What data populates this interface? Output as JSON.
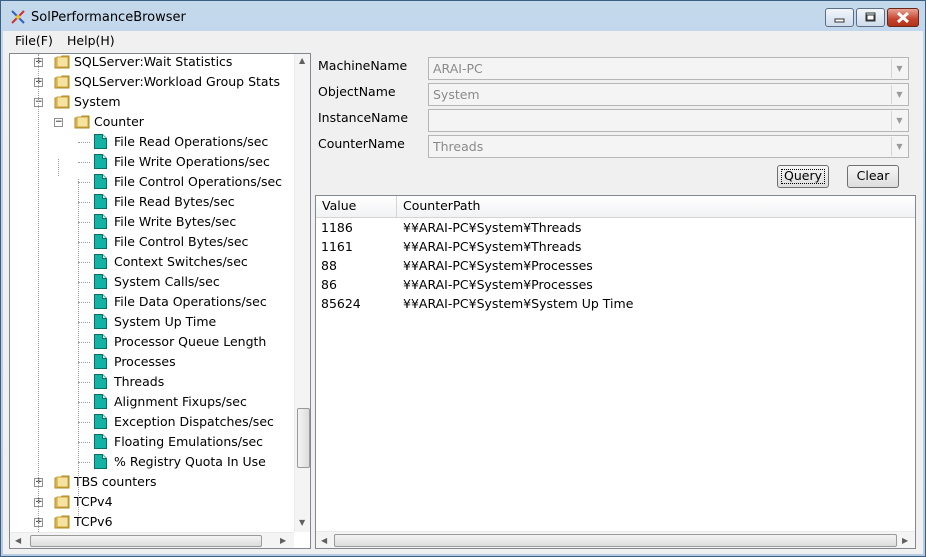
{
  "window": {
    "title": "SolPerformanceBrowser"
  },
  "menu": [
    {
      "label": "File(F)"
    },
    {
      "label": "Help(H)"
    }
  ],
  "tree": {
    "rows": [
      {
        "label": "SQLServer:Wait Statistics",
        "level": 1,
        "kind": "folder",
        "expander": "+"
      },
      {
        "label": "SQLServer:Workload Group Stats",
        "level": 1,
        "kind": "folder",
        "expander": "+"
      },
      {
        "label": "System",
        "level": 1,
        "kind": "folder",
        "expander": "-"
      },
      {
        "label": "Counter",
        "level": 2,
        "kind": "folder",
        "expander": "-"
      },
      {
        "label": "File Read Operations/sec",
        "level": 3,
        "kind": "item"
      },
      {
        "label": "File Write Operations/sec",
        "level": 3,
        "kind": "item"
      },
      {
        "label": "File Control Operations/sec",
        "level": 3,
        "kind": "item"
      },
      {
        "label": "File Read Bytes/sec",
        "level": 3,
        "kind": "item"
      },
      {
        "label": "File Write Bytes/sec",
        "level": 3,
        "kind": "item"
      },
      {
        "label": "File Control Bytes/sec",
        "level": 3,
        "kind": "item"
      },
      {
        "label": "Context Switches/sec",
        "level": 3,
        "kind": "item"
      },
      {
        "label": "System Calls/sec",
        "level": 3,
        "kind": "item"
      },
      {
        "label": "File Data Operations/sec",
        "level": 3,
        "kind": "item"
      },
      {
        "label": "System Up Time",
        "level": 3,
        "kind": "item"
      },
      {
        "label": "Processor Queue Length",
        "level": 3,
        "kind": "item"
      },
      {
        "label": "Processes",
        "level": 3,
        "kind": "item"
      },
      {
        "label": "Threads",
        "level": 3,
        "kind": "item"
      },
      {
        "label": "Alignment Fixups/sec",
        "level": 3,
        "kind": "item"
      },
      {
        "label": "Exception Dispatches/sec",
        "level": 3,
        "kind": "item"
      },
      {
        "label": "Floating Emulations/sec",
        "level": 3,
        "kind": "item"
      },
      {
        "label": "% Registry Quota In Use",
        "level": 3,
        "kind": "item"
      },
      {
        "label": "TBS counters",
        "level": 1,
        "kind": "folder",
        "expander": "+"
      },
      {
        "label": "TCPv4",
        "level": 1,
        "kind": "folder",
        "expander": "+"
      },
      {
        "label": "TCPv6",
        "level": 1,
        "kind": "folder",
        "expander": "+"
      }
    ]
  },
  "form": {
    "machine_label": "MachineName",
    "machine_value": "ARAI-PC",
    "object_label": "ObjectName",
    "object_value": "System",
    "instance_label": "InstanceName",
    "instance_value": "",
    "counter_label": "CounterName",
    "counter_value": "Threads"
  },
  "buttons": {
    "query": "Query",
    "clear": "Clear"
  },
  "results": {
    "columns": [
      "Value",
      "CounterPath"
    ],
    "rows": [
      {
        "value": "1186",
        "path": "¥¥ARAI-PC¥System¥Threads"
      },
      {
        "value": "1161",
        "path": "¥¥ARAI-PC¥System¥Threads"
      },
      {
        "value": "88",
        "path": "¥¥ARAI-PC¥System¥Processes"
      },
      {
        "value": "86",
        "path": "¥¥ARAI-PC¥System¥Processes"
      },
      {
        "value": "85624",
        "path": "¥¥ARAI-PC¥System¥System Up Time"
      }
    ]
  }
}
